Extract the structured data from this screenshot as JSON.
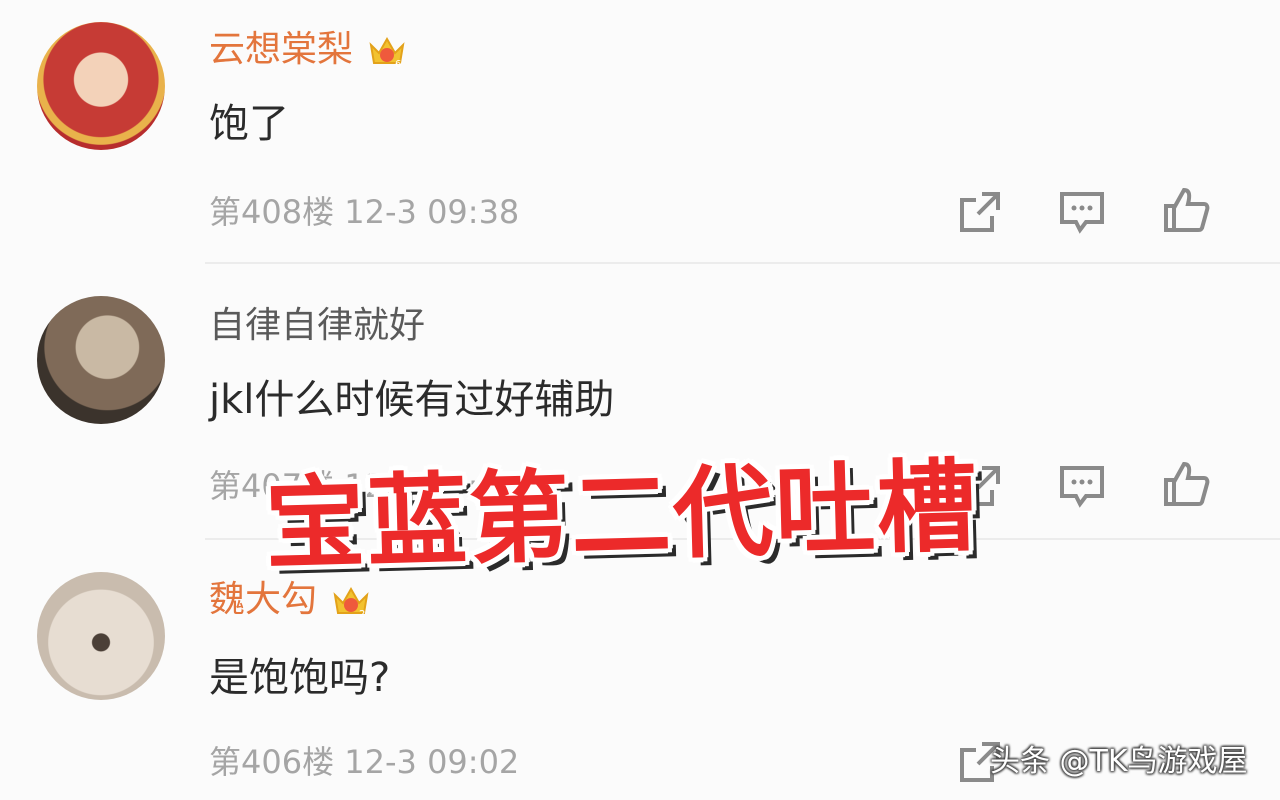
{
  "comments": [
    {
      "username": "云想棠梨",
      "vip": true,
      "text": "饱了",
      "floor": "第408楼",
      "time": "12-3 09:38"
    },
    {
      "username": "自律自律就好",
      "vip": false,
      "text": "jkl什么时候有过好辅助",
      "floor": "第407楼",
      "time": "12-3 09:37"
    },
    {
      "username": "魏大勾",
      "vip": true,
      "text": "是饱饱吗?",
      "floor": "第406楼",
      "time": "12-3 09:02"
    }
  ],
  "overlay_title": "宝蓝第二代吐槽",
  "watermark": "头条 @TK鸟游戏屋",
  "colors": {
    "vip_name": "#e3753c",
    "overlay": "#ec2a2a",
    "meta": "#a5a5a5"
  },
  "icons": [
    "share-icon",
    "comment-icon",
    "like-icon",
    "crown-icon"
  ]
}
